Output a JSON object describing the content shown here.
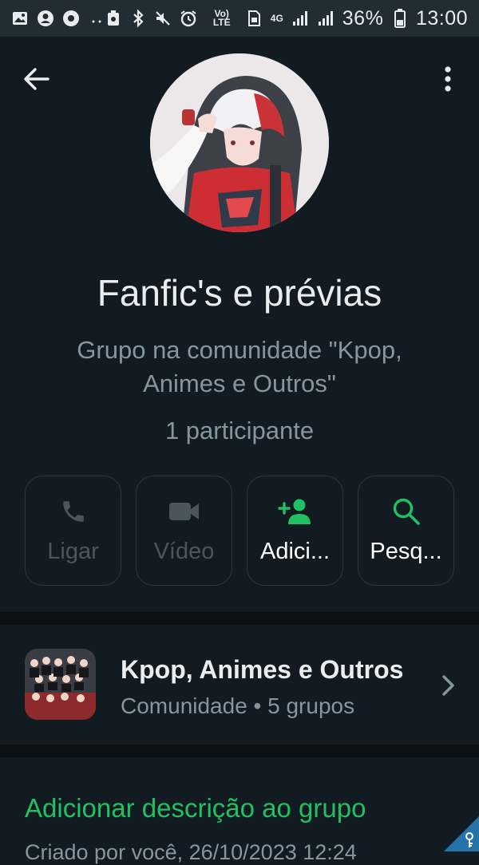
{
  "status_bar": {
    "battery_percent": "36%",
    "time": "13:00",
    "network_label": "4G",
    "volte_label": "Vo) LTE",
    "icons": [
      "image-icon",
      "account-icon",
      "record-icon",
      "dots-icon",
      "recycle-icon",
      "bluetooth-icon",
      "mute-icon",
      "alarm-icon",
      "volte-icon",
      "sim-icon",
      "data-icon",
      "signal-icon",
      "signal-icon",
      "battery-icon"
    ]
  },
  "header": {
    "group_name": "Fanfic's e prévias",
    "subtitle": "Grupo na comunidade \"Kpop, Animes e Outros\"",
    "participants": "1 participante"
  },
  "actions": [
    {
      "label": "Ligar",
      "icon": "phone-icon",
      "enabled": false
    },
    {
      "label": "Vídeo",
      "icon": "video-icon",
      "enabled": false
    },
    {
      "label": "Adici...",
      "icon": "add-person-icon",
      "enabled": true
    },
    {
      "label": "Pesq...",
      "icon": "search-icon",
      "enabled": true
    }
  ],
  "community": {
    "name": "Kpop, Animes e Outros",
    "meta": "Comunidade • 5 grupos"
  },
  "description": {
    "add_label": "Adicionar descrição ao grupo",
    "created_label": "Criado por você, 26/10/2023 12:24"
  },
  "colors": {
    "background": "#121b22",
    "accent_green": "#21c063",
    "muted_text": "#8696a0",
    "disabled": "#4b565c"
  }
}
